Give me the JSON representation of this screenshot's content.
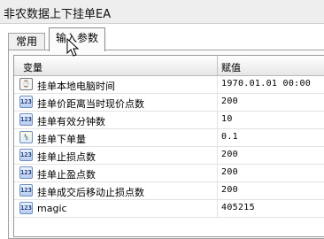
{
  "window": {
    "title": "非农数据上下挂单EA"
  },
  "tabs": [
    {
      "label": "常用"
    },
    {
      "label": "输入参数"
    }
  ],
  "grid": {
    "headers": {
      "variable": "变量",
      "value": "赋值"
    },
    "rows": [
      {
        "icon": "datetime-icon",
        "name": "挂单本地电脑时间",
        "value": "1970.01.01 00:00"
      },
      {
        "icon": "integer-icon",
        "name": "挂单价距离当时现价点数",
        "value": "200"
      },
      {
        "icon": "integer-icon",
        "name": "挂单有效分钟数",
        "value": "10"
      },
      {
        "icon": "double-icon",
        "name": "挂单下单量",
        "value": "0.1"
      },
      {
        "icon": "integer-icon",
        "name": "挂单止损点数",
        "value": "200"
      },
      {
        "icon": "integer-icon",
        "name": "挂单止盈点数",
        "value": "200"
      },
      {
        "icon": "integer-icon",
        "name": "挂单成交后移动止损点数",
        "value": "200"
      },
      {
        "icon": "integer-icon",
        "name": "magic",
        "value": "405215"
      }
    ]
  }
}
